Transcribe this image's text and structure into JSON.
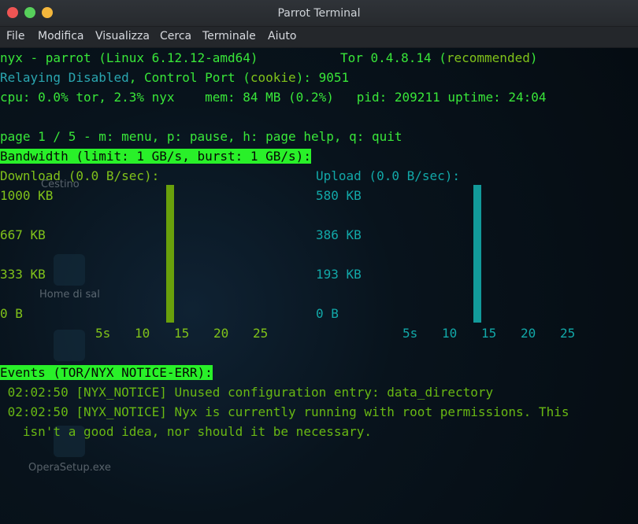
{
  "window": {
    "title": "Parrot Terminal",
    "menu": [
      "File",
      "Modifica",
      "Visualizza",
      "Cerca",
      "Terminale",
      "Aiuto"
    ]
  },
  "desktop_ghost": {
    "labels": [
      "Cestino",
      "Home di sal",
      "OperaSetup.exe"
    ]
  },
  "nyx": {
    "header": {
      "host": "nyx - parrot (Linux 6.12.12-amd64)",
      "tor_version": "Tor 0.4.8.14",
      "tor_status_open": "(",
      "tor_status": "recommended",
      "tor_status_close": ")",
      "relaying": "Relaying Disabled",
      "control_prefix": ", Control Port (",
      "auth": "cookie",
      "control_suffix": "): 9051",
      "stats": "cpu: 0.0% tor, 2.3% nyx    mem: 84 MB (0.2%)   pid: 209211 uptime: 24:04"
    },
    "page_nav": "page 1 / 5 - m: menu, p: pause, h: page help, q: quit",
    "bandwidth": {
      "title": "Bandwidth (limit: 1 GB/s, burst: 1 GB/s):",
      "download": {
        "label": "Download (0.0 B/sec):",
        "yticks": [
          "1000 KB",
          "667 KB",
          "333 KB",
          "0 B"
        ],
        "xticks": [
          "5s",
          "10",
          "15",
          "20",
          "25"
        ],
        "level": 1.0,
        "color": "#69a00b"
      },
      "upload": {
        "label": "Upload (0.0 B/sec):",
        "yticks": [
          "580 KB",
          "386 KB",
          "193 KB",
          "0 B"
        ],
        "xticks": [
          "5s",
          "10",
          "15",
          "20",
          "25"
        ],
        "level": 1.0,
        "color": "#129a9a"
      }
    },
    "events": {
      "title": "Events (TOR/NYX NOTICE-ERR):",
      "lines": [
        " 02:02:50 [NYX_NOTICE] Unused configuration entry: data_directory",
        " 02:02:50 [NYX_NOTICE] Nyx is currently running with root permissions. This",
        "   isn't a good idea, nor should it be necessary."
      ]
    }
  }
}
